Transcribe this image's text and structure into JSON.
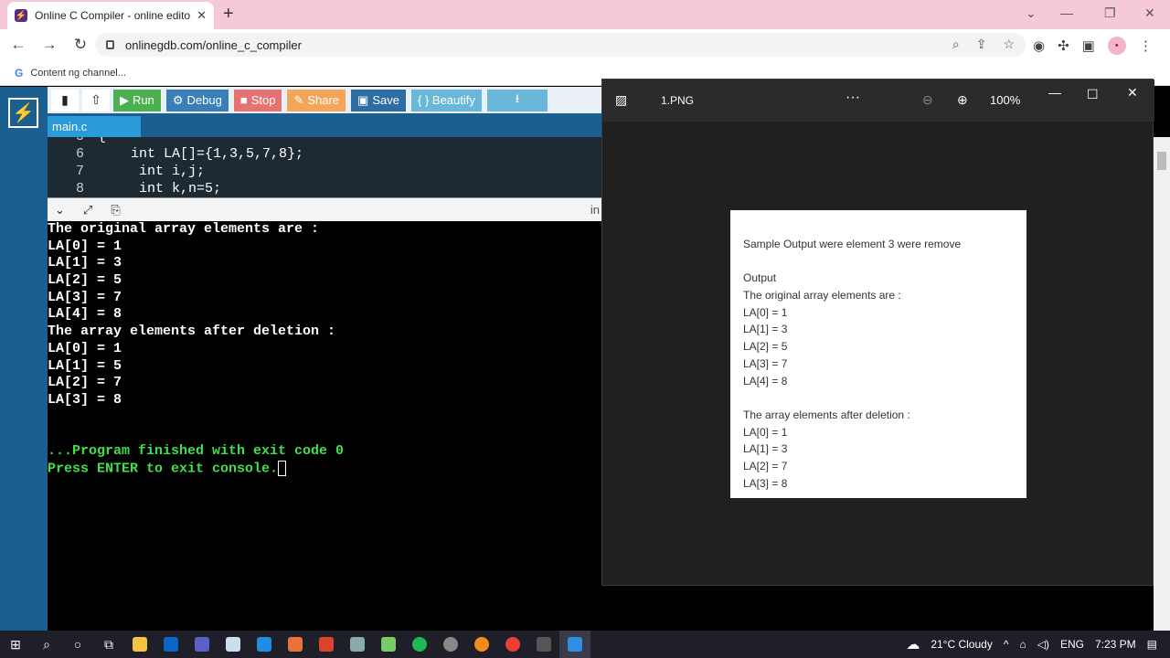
{
  "browser": {
    "tab_title": "Online C Compiler - online editor",
    "tab_close": "✕",
    "new_tab": "+",
    "url": "onlinegdb.com/online_c_compiler",
    "bookmark": "Content ng channel...",
    "avatar": "•"
  },
  "toolbar": {
    "run": "Run",
    "debug": "Debug",
    "stop": "Stop",
    "share": "Share",
    "save": "Save",
    "beautify": "{ } Beautify"
  },
  "editor": {
    "file_tab": "main.c",
    "lines": [
      {
        "n": "5",
        "code": "{"
      },
      {
        "n": "6",
        "code": "    int LA[]={1,3,5,7,8};"
      },
      {
        "n": "7",
        "code": "     int i,j;"
      },
      {
        "n": "8",
        "code": "     int k,n=5;"
      }
    ]
  },
  "console": {
    "bar_label": "in",
    "lines": [
      "The original array elements are :",
      "LA[0] = 1",
      "LA[1] = 3",
      "LA[2] = 5",
      "LA[3] = 7",
      "LA[4] = 8",
      "The array elements after deletion :",
      "LA[0] = 1",
      "LA[1] = 5",
      "LA[2] = 7",
      "LA[3] = 8",
      "",
      "",
      "...Program finished with exit code 0",
      "Press ENTER to exit console."
    ]
  },
  "viewer": {
    "file_name": "1.PNG",
    "more": "···",
    "zoom": "100%",
    "image_lines": [
      "Sample Output were element 3 were remove",
      "",
      "Output",
      "The original array elements are :",
      "LA[0] = 1",
      "LA[1] = 3",
      "LA[2] = 5",
      "LA[3] = 7",
      "LA[4] = 8",
      "",
      "The array elements after deletion :",
      "LA[0] = 1",
      "LA[1] = 3",
      "LA[2] = 7",
      "LA[3] = 8"
    ]
  },
  "taskbar": {
    "weather": "21°C  Cloudy",
    "lang": "ENG",
    "time": "7:23 PM"
  },
  "colors": {
    "accent": "#1a5f8f",
    "console_green": "#3fe04a",
    "tab_strip": "#f6c9d8"
  }
}
